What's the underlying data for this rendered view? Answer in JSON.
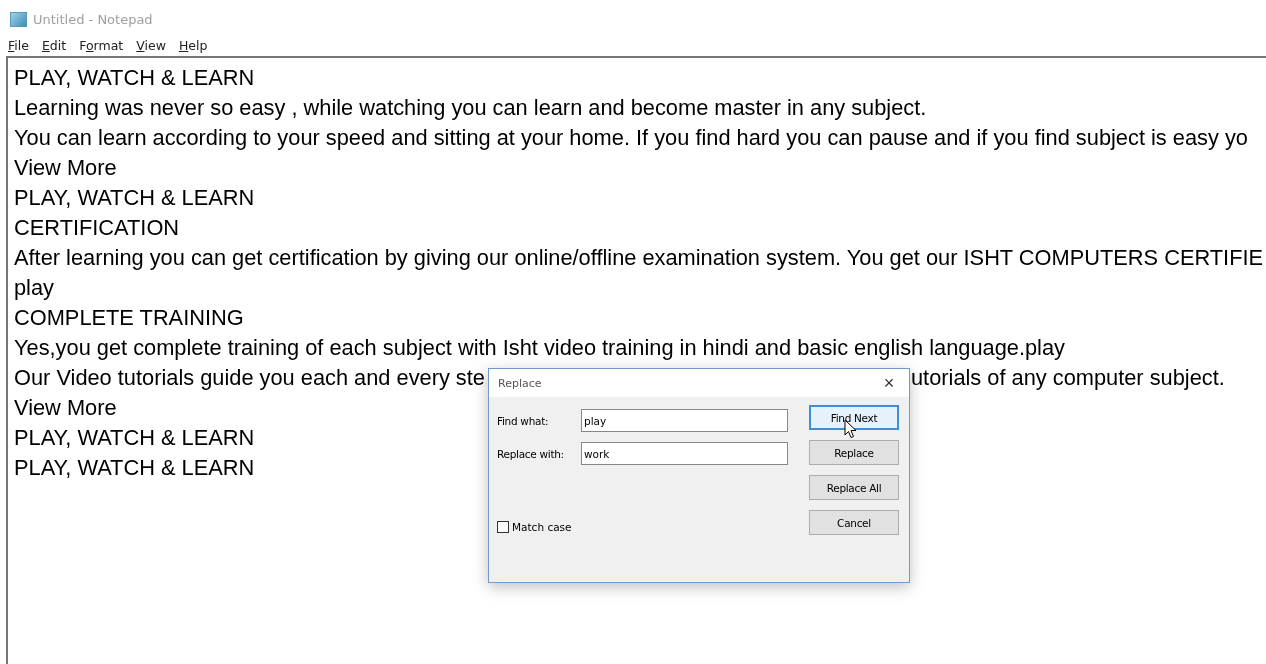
{
  "window": {
    "title": "Untitled - Notepad"
  },
  "menu": [
    {
      "key": "F",
      "rest": "ile"
    },
    {
      "key": "E",
      "rest": "dit"
    },
    {
      "before": "F",
      "key": "o",
      "rest": "rmat"
    },
    {
      "key": "V",
      "rest": "iew"
    },
    {
      "key": "H",
      "rest": "elp"
    }
  ],
  "editor": {
    "lines": [
      {
        "kind": "text",
        "text": "PLAY, WATCH & LEARN"
      },
      {
        "kind": "text",
        "text": "Learning was never so easy , while watching you can learn and become master in any subject."
      },
      {
        "kind": "text",
        "text": "You can learn according to your speed and sitting at your home. If you find hard you can pause and if you find subject is easy yo"
      },
      {
        "kind": "text",
        "text": "View More"
      },
      {
        "kind": "text",
        "text": "PLAY, WATCH & LEARN"
      },
      {
        "kind": "text",
        "text": "CERTIFICATION"
      },
      {
        "kind": "text",
        "text": "After learning you can get certification by giving our online/offline examination system. You get our ISHT COMPUTERS CERTIFIE"
      },
      {
        "kind": "text",
        "text": "play"
      },
      {
        "kind": "text",
        "text": "COMPLETE TRAINING"
      },
      {
        "kind": "text",
        "text": "Yes,you get complete training of each subject with Isht video training in hindi and basic english language.play"
      },
      {
        "kind": "covered",
        "before": "Our Video tutorials guide you each and every ste",
        "after": "utorials of any computer subject."
      },
      {
        "kind": "text",
        "text": "View More"
      },
      {
        "kind": "text",
        "text": "PLAY, WATCH & LEARN"
      },
      {
        "kind": "text",
        "text": "PLAY, WATCH & LEARN"
      }
    ]
  },
  "dialog": {
    "title": "Replace",
    "close": "×",
    "fields": [
      {
        "label": "Find what:",
        "value": "play"
      },
      {
        "label": "Replace with:",
        "value": "work"
      }
    ],
    "buttons": [
      {
        "label": "Find Next",
        "focused": true
      },
      {
        "label": "Replace",
        "focused": false
      },
      {
        "label": "Replace All",
        "focused": false
      },
      {
        "label": "Cancel",
        "focused": false
      }
    ],
    "match_case": {
      "label": "Match case",
      "checked": false
    }
  }
}
